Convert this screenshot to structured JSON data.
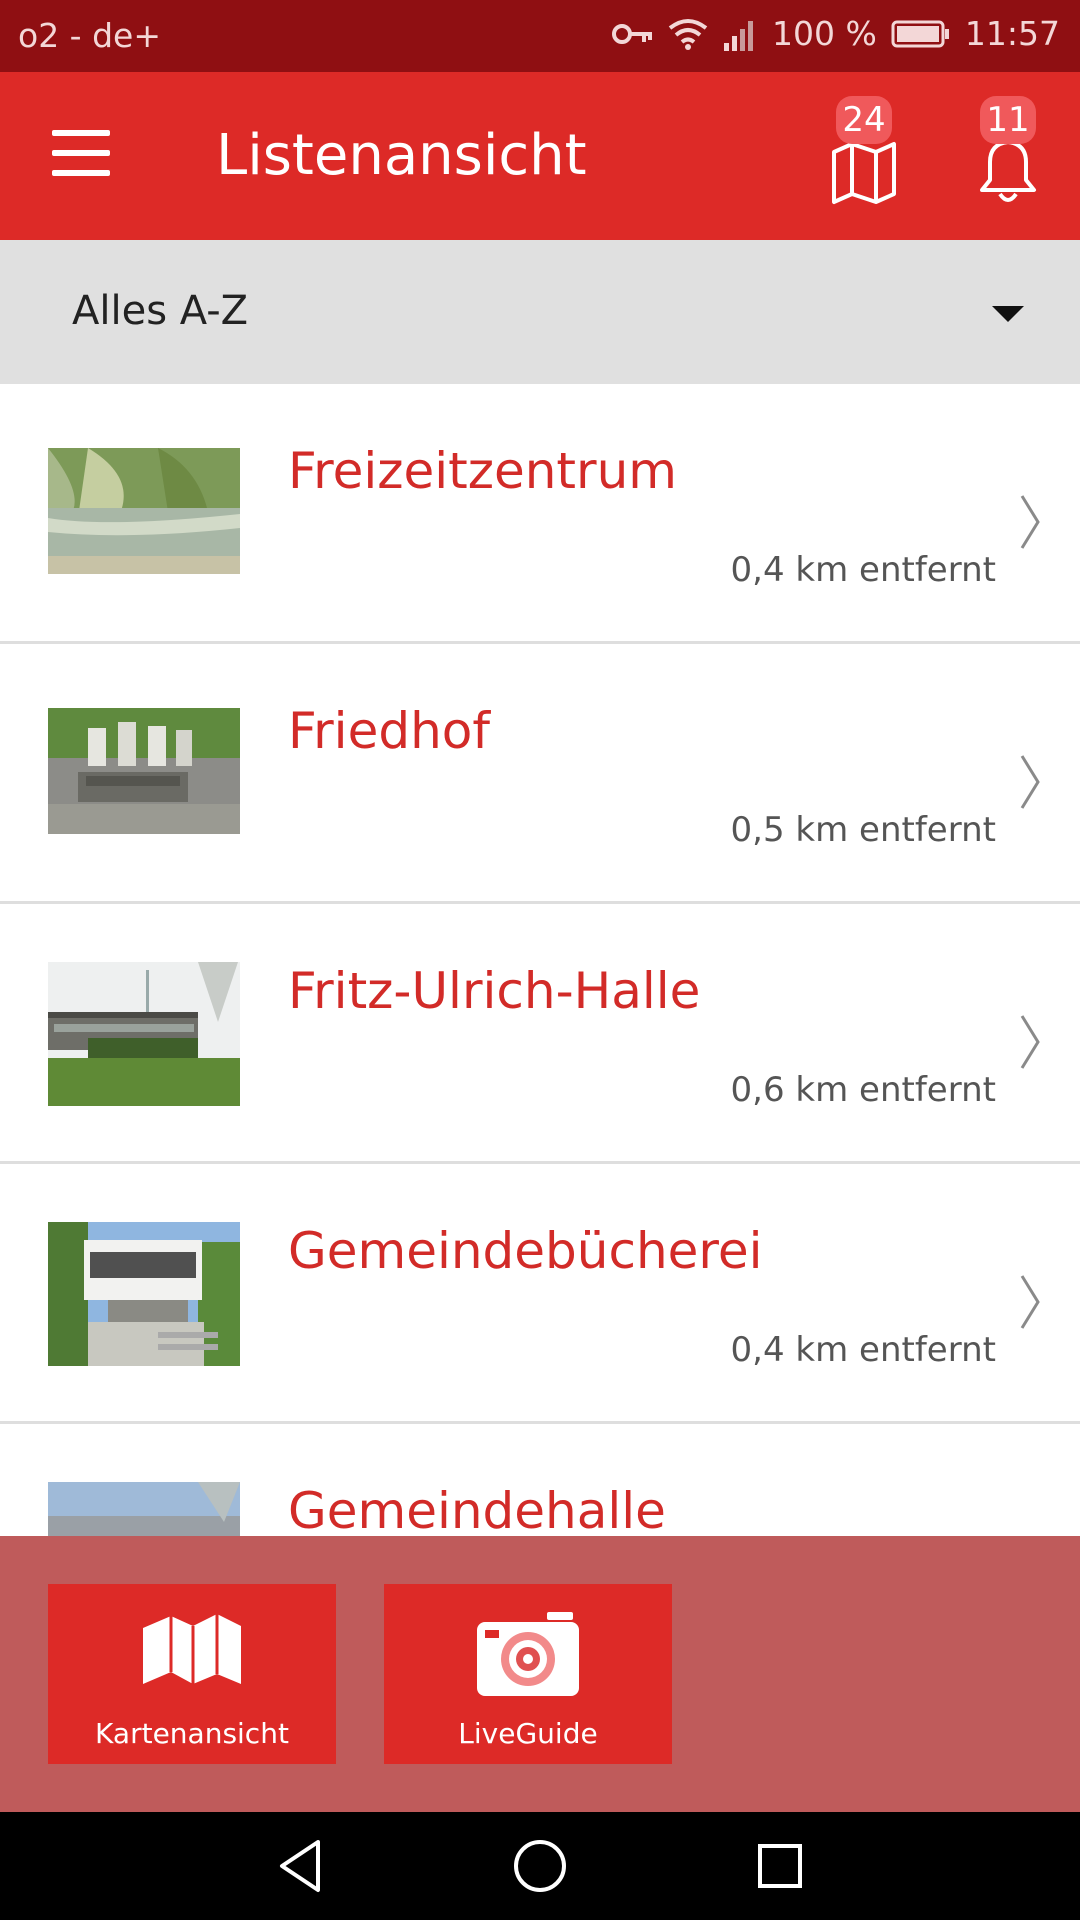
{
  "status_bar": {
    "carrier": "o2 - de+",
    "battery": "100 %",
    "time": "11:57",
    "icons": [
      "key-icon",
      "wifi-icon",
      "signal-icon",
      "battery-icon"
    ]
  },
  "app_bar": {
    "title": "Listenansicht",
    "map_badge": "24",
    "notification_badge": "11",
    "icons": [
      "menu-icon",
      "map-icon",
      "bell-icon"
    ]
  },
  "filter": {
    "selected": "Alles A-Z"
  },
  "list": [
    {
      "title": "Freizeitzentrum",
      "distance": "0,4 km entfernt",
      "thumb": "park-pond-thumbnail"
    },
    {
      "title": "Friedhof",
      "distance": "0,5 km entfernt",
      "thumb": "cemetery-thumbnail"
    },
    {
      "title": "Fritz-Ulrich-Halle",
      "distance": "0,6 km entfernt",
      "thumb": "hall-thumbnail"
    },
    {
      "title": "Gemeindebücherei",
      "distance": "0,4 km entfernt",
      "thumb": "library-thumbnail"
    },
    {
      "title": "Gemeindehalle",
      "distance": "",
      "thumb": "community-hall-thumbnail"
    }
  ],
  "bottom_actions": {
    "map_view_label": "Kartenansicht",
    "liveguide_label": "LiveGuide"
  },
  "colors": {
    "status_bar": "#8f0f12",
    "primary_red": "#dd2a27",
    "title_red": "#d22b28",
    "filter_bg": "#e0e0e0",
    "bottom_panel": "#bf5b5b",
    "badge": "#f0595b"
  }
}
